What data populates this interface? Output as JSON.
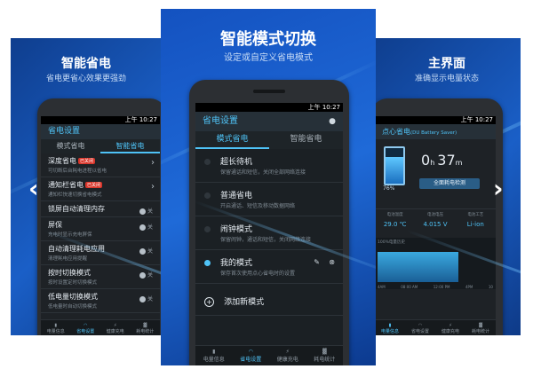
{
  "left": {
    "title": "智能省电",
    "subtitle": "省电更省心效果更强劲",
    "status_time": "上午 10:27",
    "app_title": "省电设置",
    "tabs": [
      "模式省电",
      "智能省电"
    ],
    "items": [
      {
        "title": "深度省电",
        "badge": "已关闭",
        "sub": "可切断后台耗电进程以省电",
        "control": "chevron"
      },
      {
        "title": "通知栏省电",
        "badge": "已关闭",
        "sub": "通知栏快速切换省电模式",
        "control": "chevron"
      },
      {
        "title": "锁屏自动清理内存",
        "sub": "",
        "control": "toggle",
        "value": "关"
      },
      {
        "title": "屏保",
        "sub": "充电时显示充电屏保",
        "control": "toggle",
        "value": "关"
      },
      {
        "title": "自动清理耗电应用",
        "sub": "清理耗电应用提醒",
        "control": "toggle",
        "value": "关"
      },
      {
        "title": "按时切换模式",
        "sub": "按时设置定时切换模式",
        "control": "toggle",
        "value": "关"
      },
      {
        "title": "低电量切换模式",
        "sub": "低电量时自动切换模式",
        "control": "toggle",
        "value": "关"
      }
    ],
    "nav": [
      {
        "icon": "battery-icon",
        "label": "电量信息"
      },
      {
        "icon": "gauge-icon",
        "label": "省电设置"
      },
      {
        "icon": "charging-icon",
        "label": "健康充电"
      },
      {
        "icon": "stats-icon",
        "label": "耗电统计"
      }
    ]
  },
  "center": {
    "title": "智能模式切换",
    "subtitle": "设定或自定义省电模式",
    "status_time": "上午 10:27",
    "app_title": "省电设置",
    "tabs": [
      "模式省电",
      "智能省电"
    ],
    "modes": [
      {
        "title": "超长待机",
        "sub": "保留通话和短信，关闭全部网络连接",
        "selected": false
      },
      {
        "title": "普通省电",
        "sub": "开启通话、短信及移动数据网络",
        "selected": false
      },
      {
        "title": "闹钟模式",
        "sub": "保留闹钟，通话和短信，关闭网络连接",
        "selected": false
      },
      {
        "title": "我的模式",
        "sub": "保存首次使用点心省电时的设置",
        "selected": true
      }
    ],
    "add_label": "添加新模式",
    "nav": [
      {
        "icon": "battery-icon",
        "label": "电量信息"
      },
      {
        "icon": "gauge-icon",
        "label": "省电设置"
      },
      {
        "icon": "charging-icon",
        "label": "健康充电"
      },
      {
        "icon": "stats-icon",
        "label": "耗电统计"
      }
    ]
  },
  "right": {
    "title": "主界面",
    "subtitle": "准确显示电量状态",
    "status_time": "上午 10:27",
    "app_title": "点心省电",
    "app_title_extra": "(DU Battery Saver)",
    "battery_percent": "76%",
    "battery_level": 0.76,
    "remaining_hours": "0",
    "hours_unit": "h",
    "remaining_minutes": "37",
    "minutes_unit": "m",
    "detect_button": "全面耗电检测",
    "stats": [
      {
        "label": "电池温度",
        "value": "29.0 ℃"
      },
      {
        "label": "电池电压",
        "value": "4.015 V"
      },
      {
        "label": "电池工艺",
        "value": "Li-ion"
      }
    ],
    "chart_label": "100%电量历史",
    "chart_ticks": [
      "4AM",
      "08:00 AM",
      "12:00 PM",
      "4PM",
      "10"
    ],
    "nav": [
      {
        "icon": "battery-icon",
        "label": "电量信息"
      },
      {
        "icon": "gauge-icon",
        "label": "省电设置"
      },
      {
        "icon": "charging-icon",
        "label": "健康充电"
      },
      {
        "icon": "stats-icon",
        "label": "耗电统计"
      }
    ]
  }
}
